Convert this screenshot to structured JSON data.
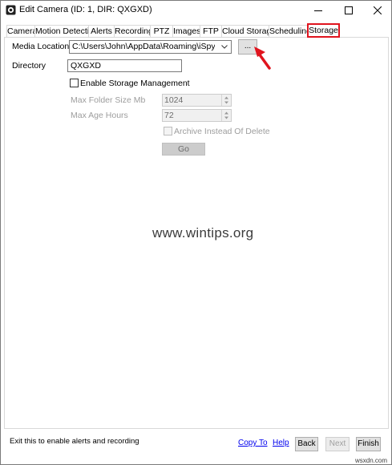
{
  "window": {
    "title": "Edit Camera (ID: 1, DIR: QXGXD)"
  },
  "tabs": [
    {
      "label": "Camera"
    },
    {
      "label": "Motion Detection"
    },
    {
      "label": "Alerts"
    },
    {
      "label": "Recording"
    },
    {
      "label": "PTZ"
    },
    {
      "label": "Images"
    },
    {
      "label": "FTP"
    },
    {
      "label": "Cloud Storage"
    },
    {
      "label": "Scheduling"
    },
    {
      "label": "Storage",
      "active": true
    }
  ],
  "storage": {
    "media_location_label": "Media Location",
    "media_location_value": "C:\\Users\\John\\AppData\\Roaming\\iSpy\\WebServerR",
    "browse_label": "...",
    "directory_label": "Directory",
    "directory_value": "QXGXD",
    "enable_storage_label": "Enable Storage Management",
    "enable_storage_checked": false,
    "max_folder_size_label": "Max Folder Size Mb",
    "max_folder_size_value": "1024",
    "max_age_hours_label": "Max Age Hours",
    "max_age_hours_value": "72",
    "archive_label": "Archive Instead Of Delete",
    "archive_checked": false,
    "go_label": "Go"
  },
  "watermark": "www.wintips.org",
  "footer": {
    "status_text": "Exit this to enable alerts and recording",
    "copy_to_label": "Copy To",
    "help_label": "Help",
    "back_label": "Back",
    "next_label": "Next",
    "finish_label": "Finish"
  },
  "credit": "wsxdn.com",
  "colors": {
    "active_tab_border": "#e0141e",
    "arrow": "#e0141e",
    "link": "#0000ee"
  }
}
